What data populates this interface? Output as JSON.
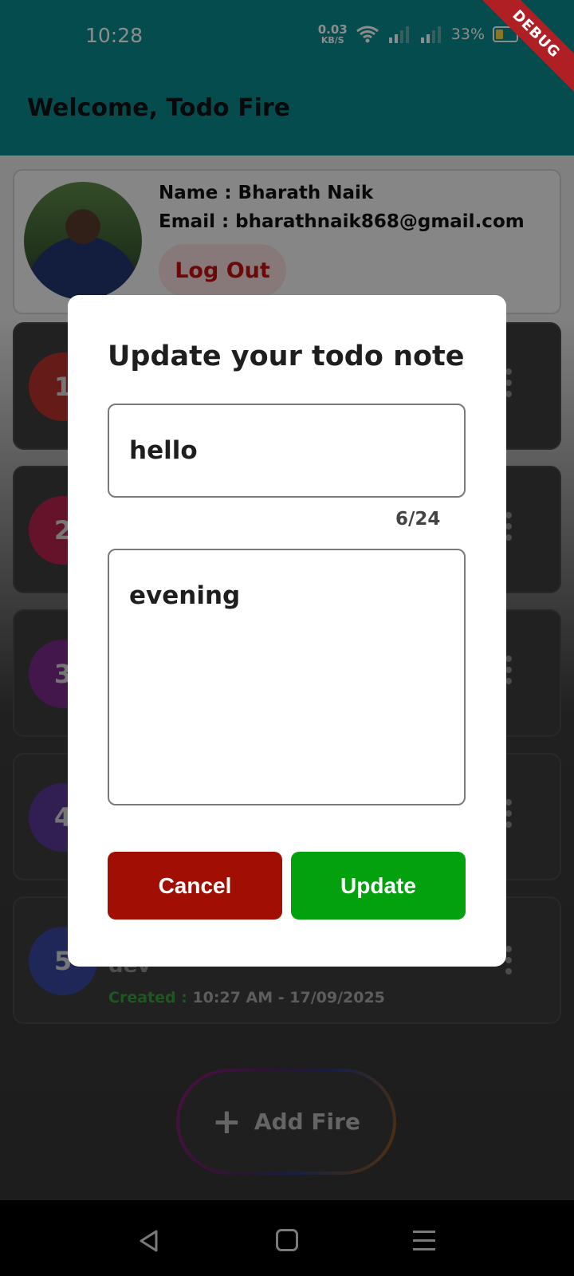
{
  "status_bar": {
    "time": "10:28",
    "net_speed_value": "0.03",
    "net_speed_unit": "KB/S",
    "battery_percent": "33%"
  },
  "debug_banner": "DEBUG",
  "app_bar": {
    "title": "Welcome, Todo Fire"
  },
  "profile": {
    "name_line": "Name : Bharath Naik",
    "email_line": "Email : bharathnaik868@gmail.com",
    "logout_label": "Log Out"
  },
  "todos": [
    {
      "number": "1",
      "color": "#b8322a"
    },
    {
      "number": "2",
      "color": "#b8234f"
    },
    {
      "number": "3",
      "color": "#7a2a8a"
    },
    {
      "number": "4",
      "color": "#5a3a9a"
    },
    {
      "number": "5",
      "color": "#3a48a0",
      "title": "dev",
      "created_label": "Created :",
      "created_value": "10:27 AM - 17/09/2025"
    }
  ],
  "fab": {
    "label": "Add Fire",
    "icon": "plus-icon"
  },
  "dialog": {
    "title": "Update your todo note",
    "title_value": "hello",
    "counter": "6/24",
    "description_value": "evening",
    "cancel_label": "Cancel",
    "update_label": "Update",
    "cancel_color": "#a10f04",
    "update_color": "#04a10f"
  },
  "colors": {
    "app_bar": "#0a8a8e"
  }
}
